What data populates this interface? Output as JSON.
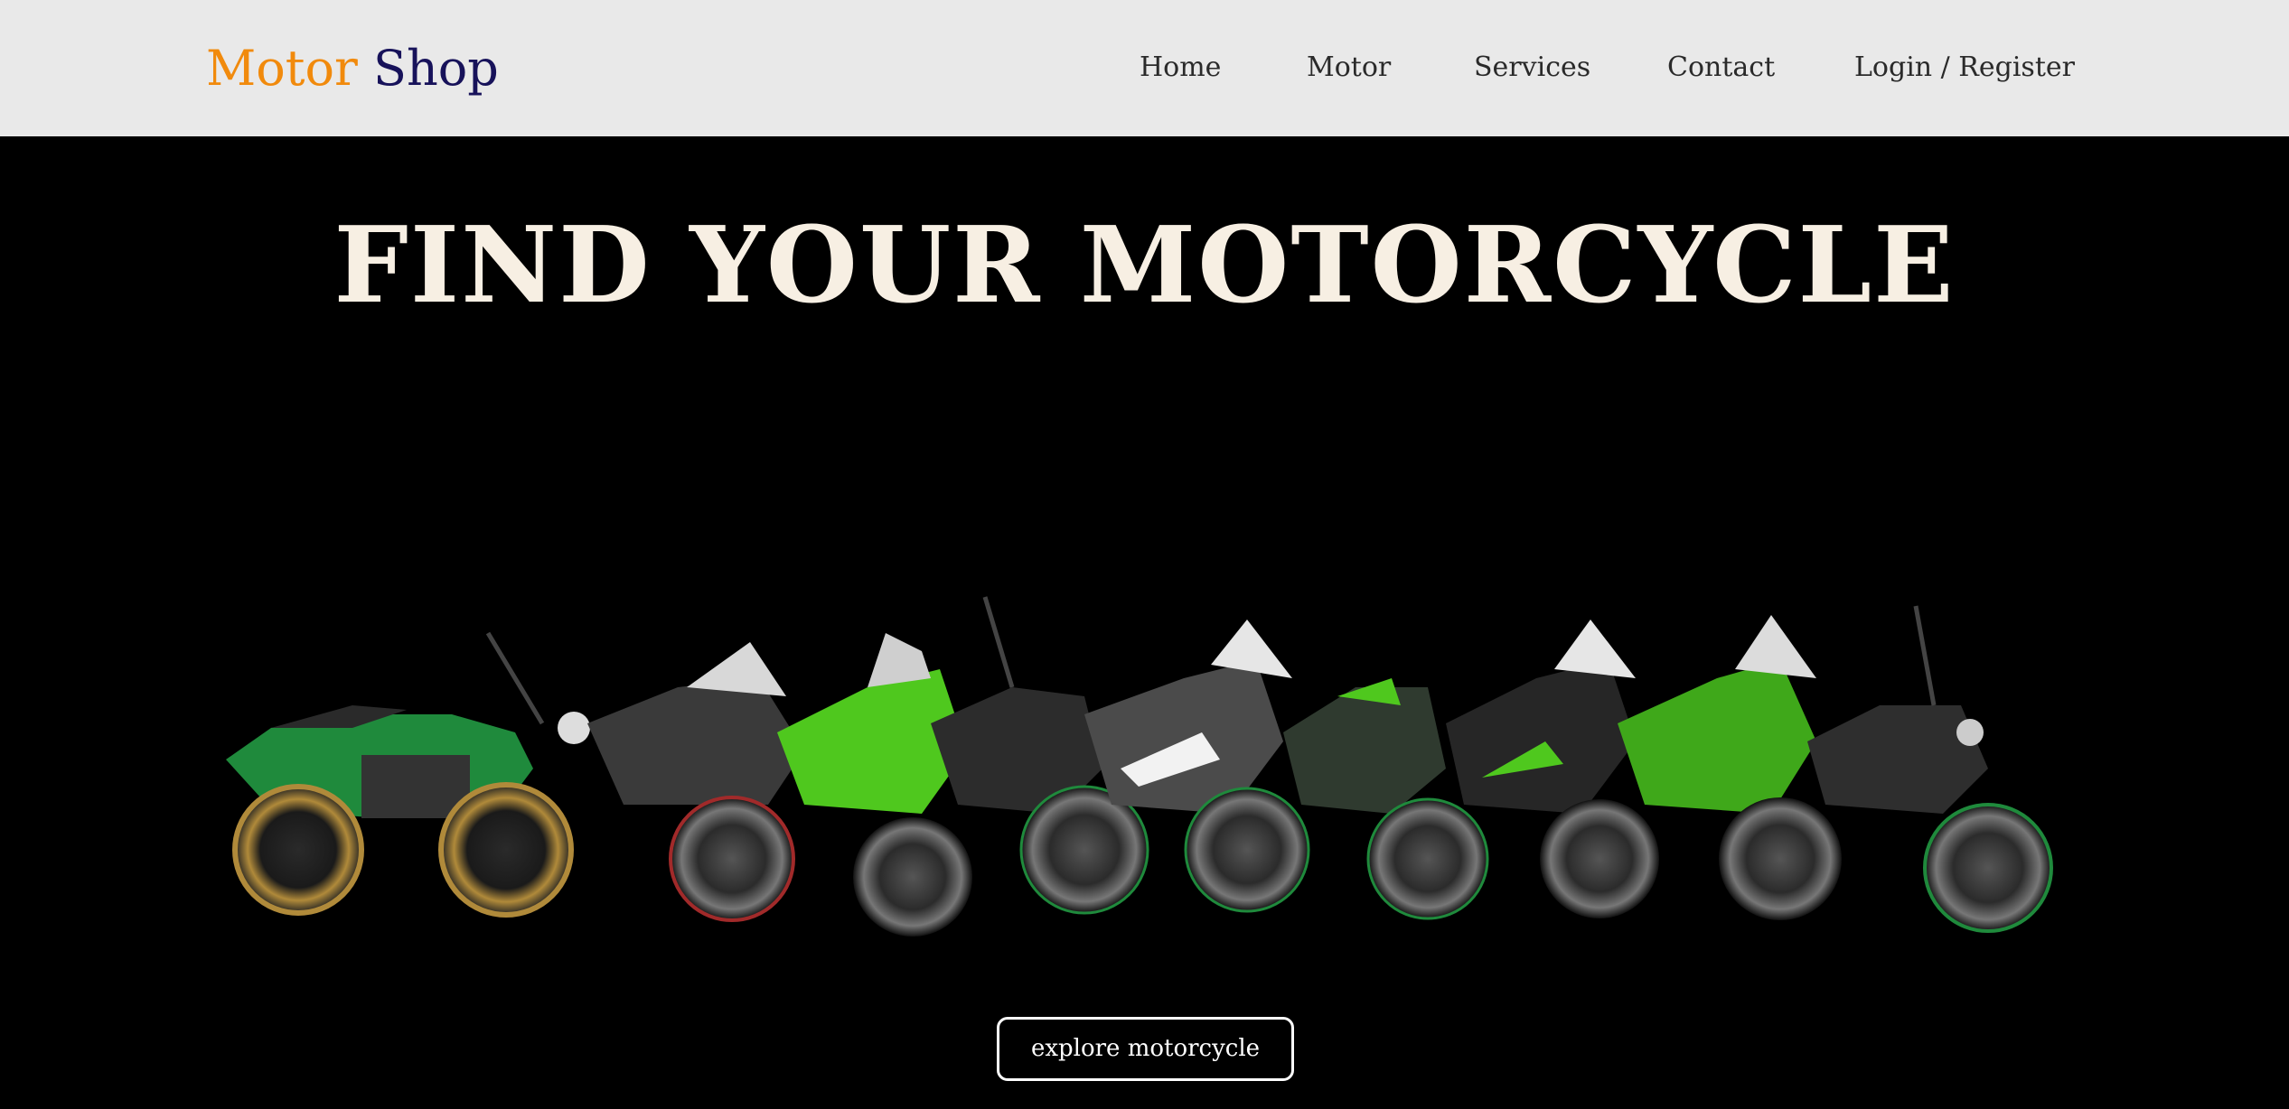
{
  "header": {
    "logo": {
      "part1": "Motor",
      "part2": "Shop"
    },
    "nav": [
      {
        "label": "Home"
      },
      {
        "label": "Motor"
      },
      {
        "label": "Services"
      },
      {
        "label": "Contact"
      },
      {
        "label": "Login / Register"
      }
    ]
  },
  "hero": {
    "title": "FIND YOUR MOTORCYCLE",
    "image": {
      "icon": "motorcycle-lineup-image",
      "count": 10
    },
    "cta_label": "explore motorcycle"
  },
  "colors": {
    "header_bg": "#e9e9e9",
    "logo_motor": "#f18a0c",
    "logo_shop": "#17125a",
    "hero_bg": "#000000",
    "hero_title": "#f7efe3",
    "bike_green": "#1f8a3c",
    "bike_lime": "#4fc81e"
  }
}
